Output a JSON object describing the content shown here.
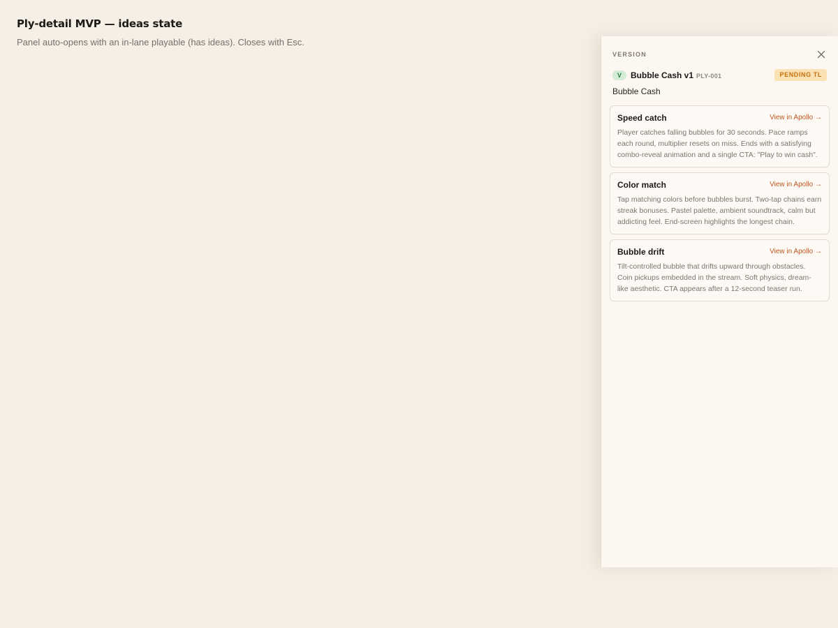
{
  "page": {
    "title": "Ply-detail MVP — ideas state",
    "subtitle": "Panel auto-opens with an in-lane playable (has ideas). Closes with Esc."
  },
  "panel": {
    "eyebrow": "VERSION",
    "close_icon": "close-icon",
    "version": {
      "badge": "V",
      "name": "Bubble Cash v1",
      "code": "PLY-001",
      "status": "PENDING TL",
      "subtitle": "Bubble Cash"
    },
    "ideas": [
      {
        "title": "Speed catch",
        "link": "View in Apollo →",
        "description": "Player catches falling bubbles for 30 seconds. Pace ramps each round, multiplier resets on miss. Ends with a satisfying combo-reveal animation and a single CTA: \"Play to win cash\"."
      },
      {
        "title": "Color match",
        "link": "View in Apollo →",
        "description": "Tap matching colors before bubbles burst. Two-tap chains earn streak bonuses. Pastel palette, ambient soundtrack, calm but addicting feel. End-screen highlights the longest chain."
      },
      {
        "title": "Bubble drift",
        "link": "View in Apollo →",
        "description": "Tilt-controlled bubble that drifts upward through obstacles. Coin pickups embedded in the stream. Soft physics, dream-like aesthetic. CTA appears after a 12-second teaser run."
      }
    ]
  },
  "colors": {
    "background": "#f6efe6",
    "panel": "#fcf7f1",
    "accent_link": "#c2571c",
    "status_bg": "#fbe2b4",
    "status_text": "#c6700a",
    "version_badge_bg": "#d2ecd5"
  }
}
